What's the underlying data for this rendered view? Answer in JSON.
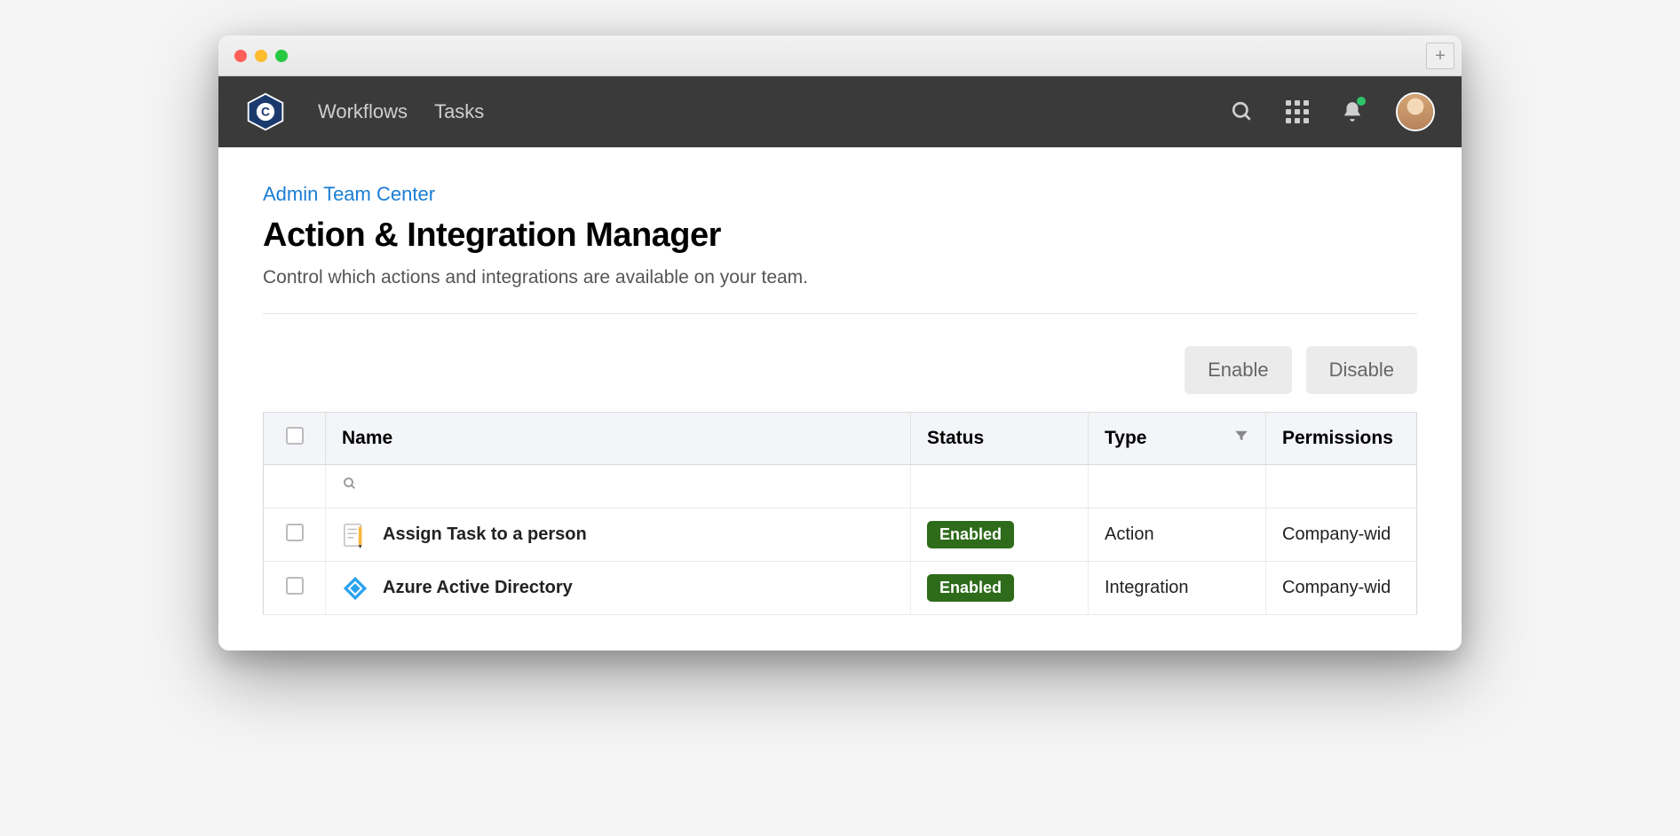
{
  "nav": {
    "links": [
      "Workflows",
      "Tasks"
    ]
  },
  "breadcrumb": "Admin Team Center",
  "title": "Action & Integration Manager",
  "subtitle": "Control which actions and integrations are available on your team.",
  "buttons": {
    "enable": "Enable",
    "disable": "Disable"
  },
  "columns": {
    "name": "Name",
    "status": "Status",
    "type": "Type",
    "permissions": "Permissions"
  },
  "rows": [
    {
      "name": "Assign Task to a person",
      "status": "Enabled",
      "type": "Action",
      "permissions": "Company-wid",
      "icon": "task"
    },
    {
      "name": "Azure Active Directory",
      "status": "Enabled",
      "type": "Integration",
      "permissions": "Company-wid",
      "icon": "azure"
    }
  ]
}
